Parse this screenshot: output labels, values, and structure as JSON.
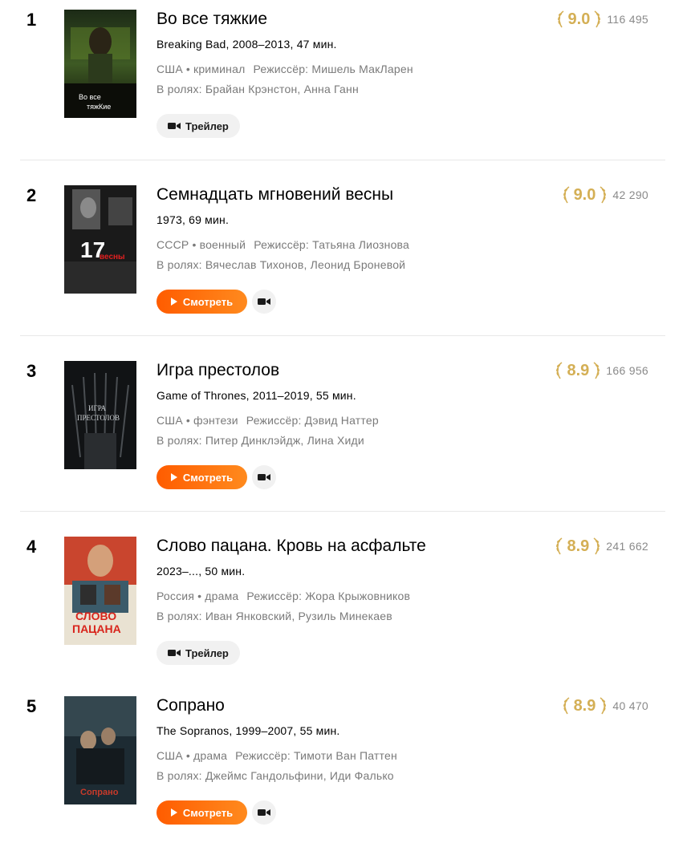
{
  "items": [
    {
      "rank": "1",
      "title": "Во все тяжкие",
      "subtitle": "Breaking Bad, 2008–2013, 47 мин.",
      "country": "США",
      "genre": "криминал",
      "director": "Режиссёр: Мишель МакЛарен",
      "cast": "В ролях: Брайан Крэнстон, Анна Ганн",
      "rating": "9.0",
      "votes": "116 495",
      "primary_button": "trailer",
      "trailer_label": "Трейлер",
      "poster_text_1": "Во все",
      "poster_text_2": "тяжКие"
    },
    {
      "rank": "2",
      "title": "Семнадцать мгновений весны",
      "subtitle": "1973, 69 мин.",
      "country": "СССР",
      "genre": "военный",
      "director": "Режиссёр: Татьяна Лиознова",
      "cast": "В ролях: Вячеслав Тихонов, Леонид Броневой",
      "rating": "9.0",
      "votes": "42 290",
      "primary_button": "watch",
      "watch_label": "Смотреть",
      "poster_text_1": "17",
      "poster_text_2": "весны"
    },
    {
      "rank": "3",
      "title": "Игра престолов",
      "subtitle": "Game of Thrones, 2011–2019, 55 мин.",
      "country": "США",
      "genre": "фэнтези",
      "director": "Режиссёр: Дэвид Наттер",
      "cast": "В ролях: Питер Динклэйдж, Лина Хиди",
      "rating": "8.9",
      "votes": "166 956",
      "primary_button": "watch",
      "watch_label": "Смотреть",
      "poster_text_1": "ИГРА",
      "poster_text_2": "ПРЕСТОЛОВ"
    },
    {
      "rank": "4",
      "title": "Слово пацана. Кровь на асфальте",
      "subtitle": "2023–..., 50 мин.",
      "country": "Россия",
      "genre": "драма",
      "director": "Режиссёр: Жора Крыжовников",
      "cast": "В ролях: Иван Янковский, Рузиль Минекаев",
      "rating": "8.9",
      "votes": "241 662",
      "primary_button": "trailer",
      "trailer_label": "Трейлер",
      "poster_text_1": "СЛОВО",
      "poster_text_2": "ПАЦАНА"
    },
    {
      "rank": "5",
      "title": "Сопрано",
      "subtitle": "The Sopranos, 1999–2007, 55 мин.",
      "country": "США",
      "genre": "драма",
      "director": "Режиссёр: Тимоти Ван Паттен",
      "cast": "В ролях: Джеймс Гандольфини, Иди Фалько",
      "rating": "8.9",
      "votes": "40 470",
      "primary_button": "watch",
      "watch_label": "Смотреть",
      "poster_text_1": "Сопрано",
      "poster_text_2": ""
    }
  ],
  "colors": {
    "rating_gold": "#d4af55",
    "watch_orange_start": "#ff5c00",
    "watch_orange_end": "#ff8a1e",
    "muted_text": "#7a7a7a"
  },
  "icons": {
    "laurel": "laurel-icon",
    "camera": "video-camera-icon",
    "play": "play-icon"
  }
}
